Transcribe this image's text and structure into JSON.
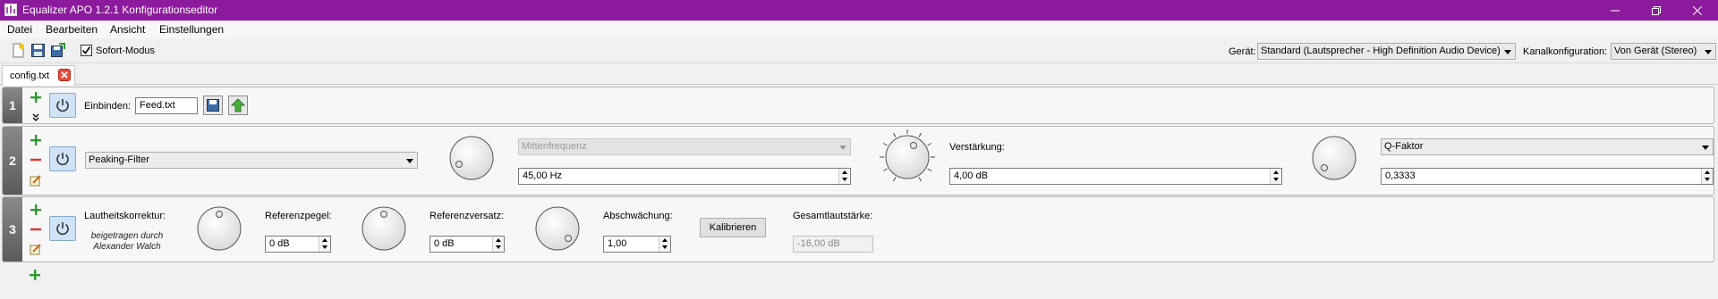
{
  "window": {
    "title": "Equalizer APO 1.2.1 Konfigurationseditor"
  },
  "menu": [
    "Datei",
    "Bearbeiten",
    "Ansicht",
    "Einstellungen"
  ],
  "toolbar": {
    "instant_mode_label": "Sofort-Modus",
    "instant_mode_checked": true,
    "device_label": "Gerät:",
    "device_value": "Standard (Lautsprecher - High Definition Audio Device)",
    "channel_label": "Kanalkonfiguration:",
    "channel_value": "Von Gerät (Stereo)"
  },
  "tabs": [
    {
      "label": "config.txt"
    }
  ],
  "filters": [
    {
      "number": "1",
      "include_label": "Einbinden:",
      "include_value": "Feed.txt"
    },
    {
      "number": "2",
      "filter_type": "Peaking-Filter",
      "frequency_param": "Mittenfrequenz",
      "frequency_value": "45,00 Hz",
      "gain_label": "Verstärkung:",
      "gain_value": "4,00 dB",
      "q_param": "Q-Faktor",
      "q_value": "0,3333"
    },
    {
      "number": "3",
      "title": "Lautheitskorrektur:",
      "credit_line1": "beigetragen durch",
      "credit_line2": "Alexander Walch",
      "ref_level_label": "Referenzpegel:",
      "ref_level_value": "0 dB",
      "ref_offset_label": "Referenzversatz:",
      "ref_offset_value": "0 dB",
      "attenuation_label": "Abschwächung:",
      "attenuation_value": "1,00",
      "calibrate_label": "Kalibrieren",
      "total_volume_label": "Gesamtlautstärke:",
      "total_volume_value": "-16,00 dB"
    }
  ],
  "colors": {
    "titlebar": "#8c1a9c",
    "add": "#2e9b2e",
    "remove": "#d9342b",
    "power_bg": "#cfe3f6"
  }
}
